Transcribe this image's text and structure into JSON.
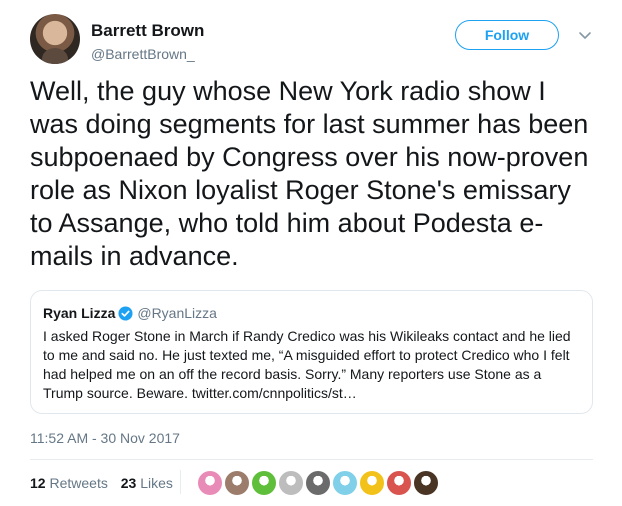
{
  "author": {
    "name": "Barrett Brown",
    "handle": "@BarrettBrown_"
  },
  "follow_label": "Follow",
  "tweet": {
    "text": "Well, the guy whose New York radio show I was doing segments for last summer has been subpoenaed by Congress over his now-proven role as Nixon loyalist Roger Stone's emissary to Assange, who told him about Podesta e-mails in advance."
  },
  "quoted_tweet": {
    "name": "Ryan Lizza",
    "handle": "@RyanLizza",
    "text": "I asked Roger Stone in March if Randy Credico was his Wikileaks contact and he lied to me and said no. He just texted me, “A misguided effort to protect Credico who I felt had helped me on an off the record basis. Sorry.” Many reporters use Stone as a Trump source. Beware. twitter.com/cnnpolitics/st…"
  },
  "timestamp": "11:52 AM - 30 Nov 2017",
  "stats": {
    "retweets_count": "12",
    "retweets_label": "Retweets",
    "likes_count": "23",
    "likes_label": "Likes"
  },
  "icons": {
    "avatar": "profile-photo",
    "menu": "chevron-down-icon",
    "verified": "verified-badge-icon"
  },
  "colors": {
    "accent": "#1da1f2",
    "text": "#14171a",
    "secondary": "#657786",
    "border": "#e1e8ed"
  },
  "likers": [
    {
      "color": "#e98bb7"
    },
    {
      "color": "#9c7c6a"
    },
    {
      "color": "#5fbf3a"
    },
    {
      "color": "#bdbdbd"
    },
    {
      "color": "#6b6b6b"
    },
    {
      "color": "#7fd0e8"
    },
    {
      "color": "#f2c21b"
    },
    {
      "color": "#d9534f"
    },
    {
      "color": "#4a3424"
    }
  ]
}
